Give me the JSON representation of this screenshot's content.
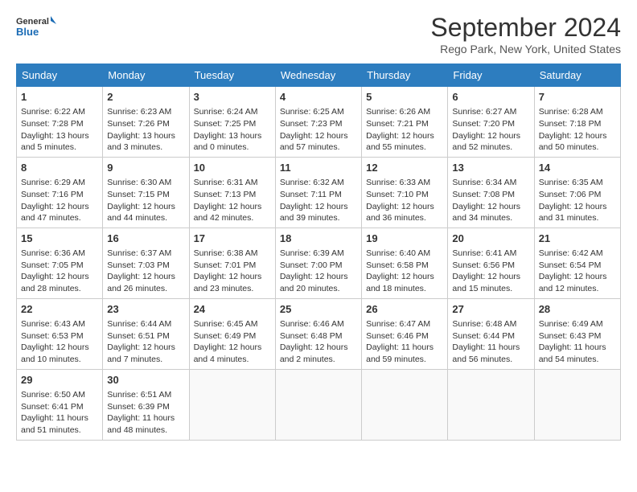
{
  "header": {
    "logo_line1": "General",
    "logo_line2": "Blue",
    "title": "September 2024",
    "subtitle": "Rego Park, New York, United States"
  },
  "columns": [
    "Sunday",
    "Monday",
    "Tuesday",
    "Wednesday",
    "Thursday",
    "Friday",
    "Saturday"
  ],
  "weeks": [
    [
      {
        "day": "1",
        "info": "Sunrise: 6:22 AM\nSunset: 7:28 PM\nDaylight: 13 hours\nand 5 minutes."
      },
      {
        "day": "2",
        "info": "Sunrise: 6:23 AM\nSunset: 7:26 PM\nDaylight: 13 hours\nand 3 minutes."
      },
      {
        "day": "3",
        "info": "Sunrise: 6:24 AM\nSunset: 7:25 PM\nDaylight: 13 hours\nand 0 minutes."
      },
      {
        "day": "4",
        "info": "Sunrise: 6:25 AM\nSunset: 7:23 PM\nDaylight: 12 hours\nand 57 minutes."
      },
      {
        "day": "5",
        "info": "Sunrise: 6:26 AM\nSunset: 7:21 PM\nDaylight: 12 hours\nand 55 minutes."
      },
      {
        "day": "6",
        "info": "Sunrise: 6:27 AM\nSunset: 7:20 PM\nDaylight: 12 hours\nand 52 minutes."
      },
      {
        "day": "7",
        "info": "Sunrise: 6:28 AM\nSunset: 7:18 PM\nDaylight: 12 hours\nand 50 minutes."
      }
    ],
    [
      {
        "day": "8",
        "info": "Sunrise: 6:29 AM\nSunset: 7:16 PM\nDaylight: 12 hours\nand 47 minutes."
      },
      {
        "day": "9",
        "info": "Sunrise: 6:30 AM\nSunset: 7:15 PM\nDaylight: 12 hours\nand 44 minutes."
      },
      {
        "day": "10",
        "info": "Sunrise: 6:31 AM\nSunset: 7:13 PM\nDaylight: 12 hours\nand 42 minutes."
      },
      {
        "day": "11",
        "info": "Sunrise: 6:32 AM\nSunset: 7:11 PM\nDaylight: 12 hours\nand 39 minutes."
      },
      {
        "day": "12",
        "info": "Sunrise: 6:33 AM\nSunset: 7:10 PM\nDaylight: 12 hours\nand 36 minutes."
      },
      {
        "day": "13",
        "info": "Sunrise: 6:34 AM\nSunset: 7:08 PM\nDaylight: 12 hours\nand 34 minutes."
      },
      {
        "day": "14",
        "info": "Sunrise: 6:35 AM\nSunset: 7:06 PM\nDaylight: 12 hours\nand 31 minutes."
      }
    ],
    [
      {
        "day": "15",
        "info": "Sunrise: 6:36 AM\nSunset: 7:05 PM\nDaylight: 12 hours\nand 28 minutes."
      },
      {
        "day": "16",
        "info": "Sunrise: 6:37 AM\nSunset: 7:03 PM\nDaylight: 12 hours\nand 26 minutes."
      },
      {
        "day": "17",
        "info": "Sunrise: 6:38 AM\nSunset: 7:01 PM\nDaylight: 12 hours\nand 23 minutes."
      },
      {
        "day": "18",
        "info": "Sunrise: 6:39 AM\nSunset: 7:00 PM\nDaylight: 12 hours\nand 20 minutes."
      },
      {
        "day": "19",
        "info": "Sunrise: 6:40 AM\nSunset: 6:58 PM\nDaylight: 12 hours\nand 18 minutes."
      },
      {
        "day": "20",
        "info": "Sunrise: 6:41 AM\nSunset: 6:56 PM\nDaylight: 12 hours\nand 15 minutes."
      },
      {
        "day": "21",
        "info": "Sunrise: 6:42 AM\nSunset: 6:54 PM\nDaylight: 12 hours\nand 12 minutes."
      }
    ],
    [
      {
        "day": "22",
        "info": "Sunrise: 6:43 AM\nSunset: 6:53 PM\nDaylight: 12 hours\nand 10 minutes."
      },
      {
        "day": "23",
        "info": "Sunrise: 6:44 AM\nSunset: 6:51 PM\nDaylight: 12 hours\nand 7 minutes."
      },
      {
        "day": "24",
        "info": "Sunrise: 6:45 AM\nSunset: 6:49 PM\nDaylight: 12 hours\nand 4 minutes."
      },
      {
        "day": "25",
        "info": "Sunrise: 6:46 AM\nSunset: 6:48 PM\nDaylight: 12 hours\nand 2 minutes."
      },
      {
        "day": "26",
        "info": "Sunrise: 6:47 AM\nSunset: 6:46 PM\nDaylight: 11 hours\nand 59 minutes."
      },
      {
        "day": "27",
        "info": "Sunrise: 6:48 AM\nSunset: 6:44 PM\nDaylight: 11 hours\nand 56 minutes."
      },
      {
        "day": "28",
        "info": "Sunrise: 6:49 AM\nSunset: 6:43 PM\nDaylight: 11 hours\nand 54 minutes."
      }
    ],
    [
      {
        "day": "29",
        "info": "Sunrise: 6:50 AM\nSunset: 6:41 PM\nDaylight: 11 hours\nand 51 minutes."
      },
      {
        "day": "30",
        "info": "Sunrise: 6:51 AM\nSunset: 6:39 PM\nDaylight: 11 hours\nand 48 minutes."
      },
      {
        "day": "",
        "info": ""
      },
      {
        "day": "",
        "info": ""
      },
      {
        "day": "",
        "info": ""
      },
      {
        "day": "",
        "info": ""
      },
      {
        "day": "",
        "info": ""
      }
    ]
  ]
}
